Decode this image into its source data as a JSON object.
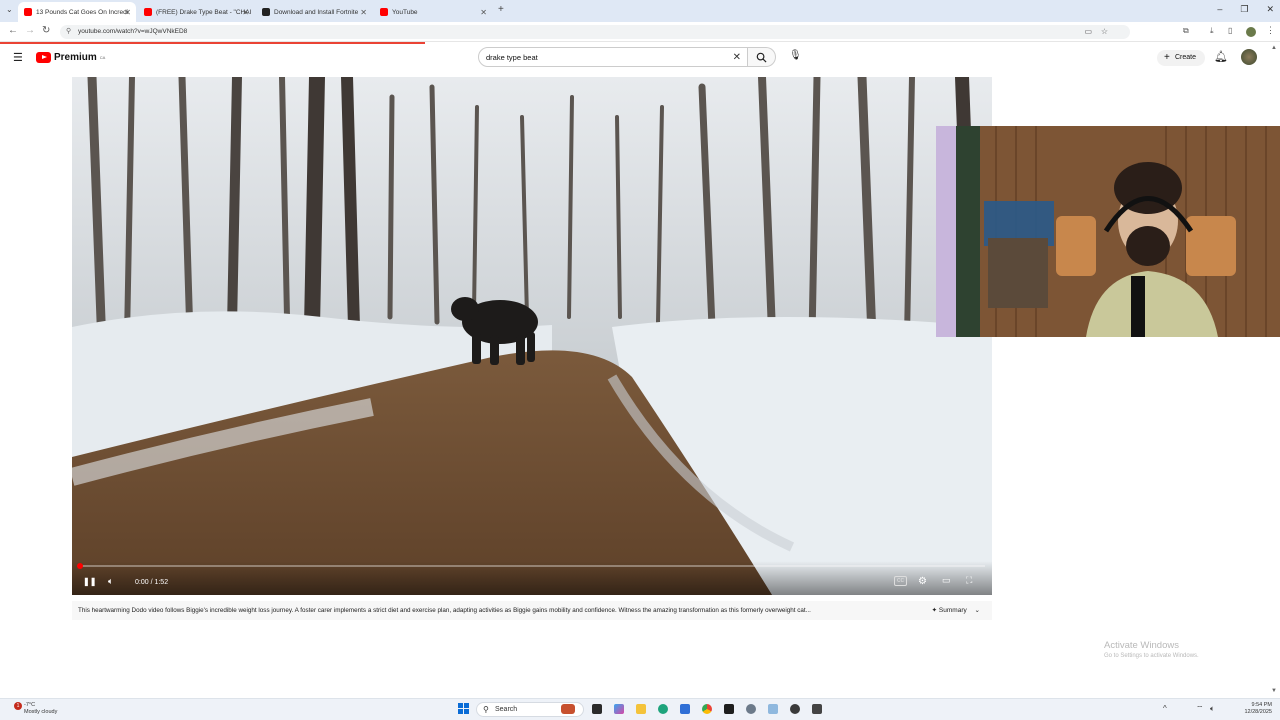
{
  "browser": {
    "tabs": [
      {
        "title": "13 Pounds Cat Goes On Incredi",
        "favicon_color": "#ff0000",
        "active": true
      },
      {
        "title": "(FREE) Drake Type Beat - \"CHAI",
        "favicon_color": "#ff0000",
        "active": false
      },
      {
        "title": "Download and Install Fortnite",
        "favicon_color": "#222222",
        "active": false
      },
      {
        "title": "YouTube",
        "favicon_color": "#ff0000",
        "active": false
      }
    ],
    "url": "youtube.com/watch?v=wJQwVNkED8"
  },
  "youtube": {
    "brand": "Premium",
    "brand_sup": "CA",
    "search_query": "drake type beat",
    "create_label": "Create"
  },
  "player": {
    "time": "0:00 / 1:52",
    "progress_fraction": 0.0
  },
  "description": {
    "text": "This heartwarming Dodo video follows Biggie's incredible weight loss journey. A foster carer implements a strict diet and exercise plan, adapting activities as Biggie gains mobility and confidence. Witness the amazing transformation as this formerly overweight cat...",
    "summary_label": "Summary"
  },
  "watermark": {
    "title": "Activate Windows",
    "subtitle": "Go to Settings to activate Windows."
  },
  "taskbar": {
    "weather_badge": "1",
    "temp": "-7°C",
    "condition": "Mostly cloudy",
    "search_label": "Search",
    "time": "9:54 PM",
    "date": "12/28/2025"
  },
  "colors": {
    "accent": "#ff0000",
    "tabbar": "#dfe8f5"
  }
}
